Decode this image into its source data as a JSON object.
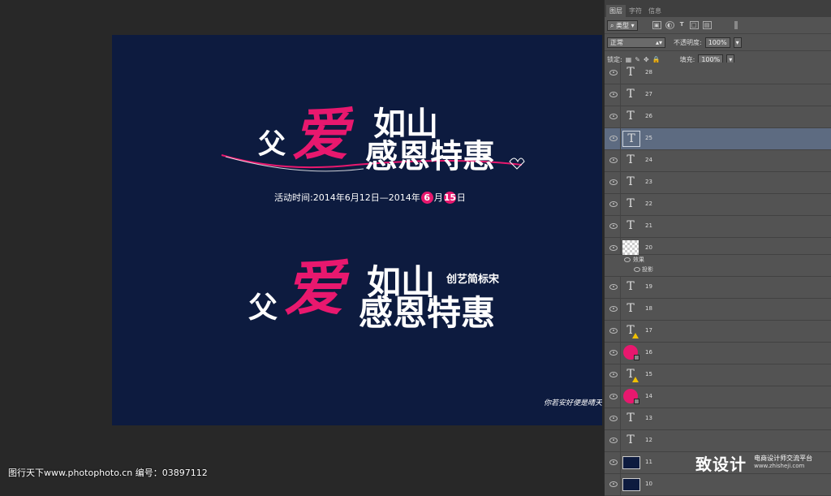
{
  "canvas": {
    "bg": "#0d1b3f",
    "accent": "#e8186e",
    "design1": {
      "chars": [
        "父",
        "爱",
        "如山",
        "感恩特惠"
      ],
      "date_prefix": "活动时间:2014年6月12日—2014年",
      "date_month": "6",
      "date_month_unit": "月",
      "date_day": "15",
      "date_day_unit": "日"
    },
    "design2": {
      "chars": [
        "父",
        "爱",
        "如山",
        "感恩特惠"
      ],
      "font_name": "创艺简标宋"
    },
    "tagline": "你若安好便是晴天"
  },
  "panel": {
    "tabs": [
      "图层",
      "字符",
      "信息"
    ],
    "filter_label": "类型",
    "filter_icons": [
      "image-filter-icon",
      "adjust-filter-icon",
      "type-filter-icon",
      "shape-filter-icon",
      "smart-filter-icon"
    ],
    "blend_mode": "正常",
    "opacity_label": "不透明度:",
    "opacity_value": "100%",
    "lock_label": "锁定:",
    "lock_icons": [
      "lock-pixels-icon",
      "lock-paint-icon",
      "lock-move-icon",
      "lock-all-icon"
    ],
    "fill_label": "填充:",
    "fill_value": "100%",
    "layers": [
      {
        "name": "28",
        "type": "text"
      },
      {
        "name": "27",
        "type": "text"
      },
      {
        "name": "26",
        "type": "text"
      },
      {
        "name": "25",
        "type": "text",
        "selected": true
      },
      {
        "name": "24",
        "type": "text"
      },
      {
        "name": "23",
        "type": "text"
      },
      {
        "name": "22",
        "type": "text"
      },
      {
        "name": "21",
        "type": "text"
      },
      {
        "name": "20",
        "type": "pixel",
        "effects_label": "效果",
        "effect": "投影"
      },
      {
        "name": "19",
        "type": "text"
      },
      {
        "name": "18",
        "type": "text"
      },
      {
        "name": "17",
        "type": "text",
        "warning": true
      },
      {
        "name": "16",
        "type": "circle"
      },
      {
        "name": "15",
        "type": "text",
        "warning": true
      },
      {
        "name": "14",
        "type": "circle"
      },
      {
        "name": "13",
        "type": "text"
      },
      {
        "name": "12",
        "type": "text"
      },
      {
        "name": "11",
        "type": "navy"
      },
      {
        "name": "10",
        "type": "navy"
      }
    ]
  },
  "watermark": {
    "left": "图行天下www.photophoto.cn  编号：03897112",
    "logo": "致设计",
    "right_cn": "电商设计师交流平台",
    "right_url": "www.zhisheji.com"
  }
}
